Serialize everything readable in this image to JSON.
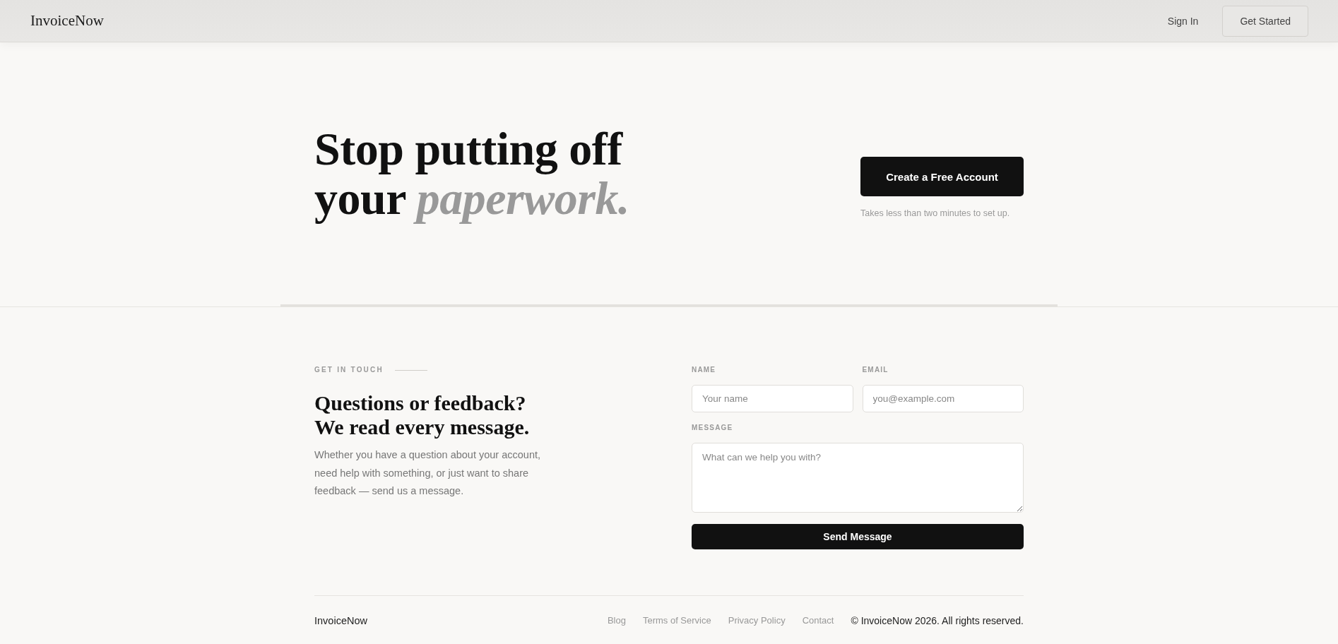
{
  "header": {
    "logo": "InvoiceNow",
    "nav": [
      {
        "kind": "link",
        "label": "Sign In"
      },
      {
        "kind": "button",
        "label": "Get Started"
      }
    ]
  },
  "hero": {
    "headline": "Stop putting off your *paperwork.*",
    "cta": {
      "label": "Create a Free Account",
      "note": "Takes less than two minutes to set up."
    }
  },
  "contact": {
    "eyebrow": "GET IN TOUCH",
    "title": "Questions or feedback? We read every message.",
    "text": "Whether you have a question about your account, need help with something, or just want to share feedback — send us a message.",
    "form": {
      "fields": [
        {
          "kind": "input",
          "label": "NAME",
          "placeholder": "Your name"
        },
        {
          "kind": "input",
          "label": "EMAIL",
          "placeholder": "you@example.com"
        },
        {
          "kind": "textarea",
          "label": "MESSAGE",
          "placeholder": "What can we help you with?"
        }
      ],
      "submit": "Send Message"
    }
  },
  "footer": {
    "brand": "InvoiceNow",
    "links": [
      "Blog",
      "Terms of Service",
      "Privacy Policy",
      "Contact"
    ],
    "copyright": "© InvoiceNow 2026. All rights reserved."
  }
}
